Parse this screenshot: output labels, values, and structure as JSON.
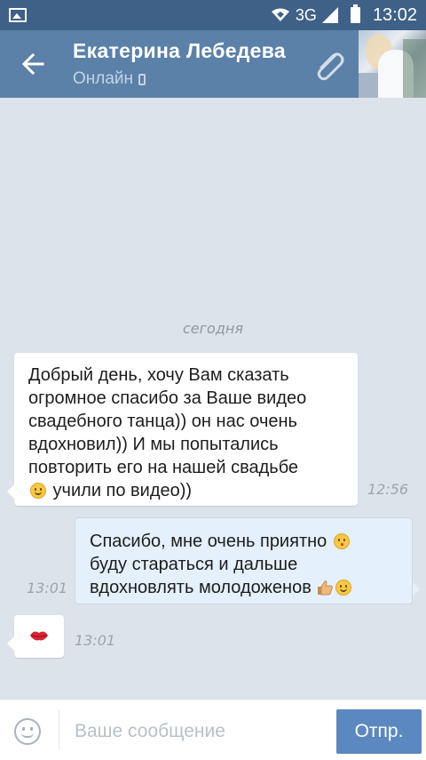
{
  "status_bar": {
    "network": "3G",
    "time": "13:02"
  },
  "header": {
    "contact_name": "Екатерина Лебедева",
    "status": "Онлайн"
  },
  "chat": {
    "date_separator": "сегодня",
    "messages": [
      {
        "direction": "incoming",
        "lines": [
          "Добрый день, хочу Вам сказать",
          "огромное спасибо за Ваше видео",
          "свадебного танца)) он нас очень",
          "вдохновил)) И мы попытались",
          "повторить его на нашей свадьбе"
        ],
        "last_line_after_emoji": " учили по видео))",
        "emoji": "smile-emoji",
        "time": "12:56"
      },
      {
        "direction": "outgoing",
        "lines": [
          "Спасибо, мне очень приятно",
          "буду стараться и дальше",
          "вдохновлять молодоженов"
        ],
        "emoji": [
          "kiss-emoji",
          "thumbs-up-emoji",
          "smile-emoji"
        ],
        "time": "13:01"
      },
      {
        "direction": "incoming",
        "sticker": "kiss-lips-emoji",
        "time": "13:01"
      }
    ]
  },
  "composer": {
    "placeholder": "Ваше сообщение",
    "value": "",
    "send_label": "Отпр."
  },
  "colors": {
    "status_bar": "#3f6187",
    "header": "#5b81a9",
    "chat_background": "#dde3ea",
    "incoming_bubble": "#ffffff",
    "outgoing_bubble": "#e4f0fb",
    "send_button": "#5b88c0"
  }
}
